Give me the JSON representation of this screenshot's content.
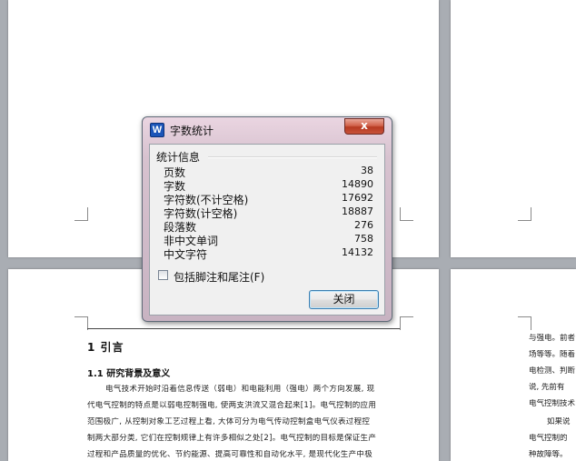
{
  "dialog": {
    "title": "字数统计",
    "app_icon_letter": "W",
    "close_symbol": "x",
    "group_label": "统计信息",
    "stats": [
      {
        "label": "页数",
        "value": "38"
      },
      {
        "label": "字数",
        "value": "14890"
      },
      {
        "label": "字符数(不计空格)",
        "value": "17692"
      },
      {
        "label": "字符数(计空格)",
        "value": "18887"
      },
      {
        "label": "段落数",
        "value": "276"
      },
      {
        "label": "非中文单词",
        "value": "758"
      },
      {
        "label": "中文字符",
        "value": "14132"
      }
    ],
    "checkbox_label": "包括脚注和尾注(F)",
    "checkbox_checked": false,
    "close_button_label": "关闭"
  },
  "document": {
    "heading1": "1   引言",
    "heading2": "1.1   研究背景及意义",
    "lines": [
      "电气技术开始时沿着信息传送（弱电）和电能利用（强电）两个方向发展, 现",
      "代电气控制的特点是以弱电控制强电, 使两支洪流又混合起来[1]。电气控制的应用",
      "范围极广, 从控制对象工艺过程上看, 大体可分为电气传动控制盒电气仪表过程控",
      "制两大部分类, 它们在控制规律上有许多相似之处[2]。电气控制的目标是保证生产",
      "过程和产品质量的优化、节约能源、提高可靠性和自动化水平, 是现代化生产中极"
    ],
    "right_lines": [
      "与强电。前者",
      "场等等。随着",
      "电检测、判断",
      "说, 先前有",
      "电气控制技术",
      "如果说",
      "电气控制的",
      "种故障等。"
    ]
  }
}
